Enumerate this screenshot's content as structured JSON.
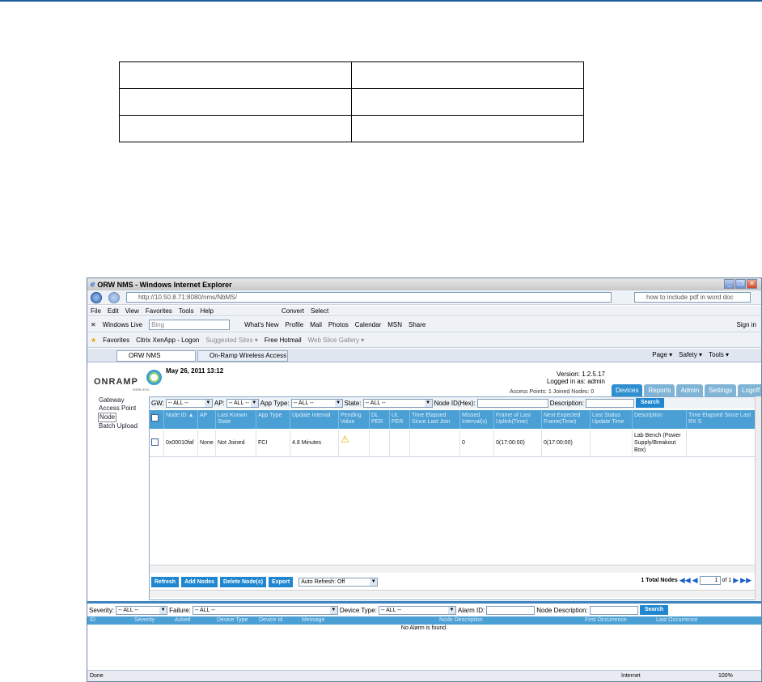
{
  "browser": {
    "title": "ORW NMS - Windows Internet Explorer",
    "url": "http://10.50.8.71:8080/nms/NbMS/",
    "search_text": "how to include pdf in word doc",
    "menu": [
      "File",
      "Edit",
      "View",
      "Favorites",
      "Tools",
      "Help"
    ],
    "convert_label": "Convert",
    "select_label": "Select",
    "toolbar2": {
      "windows_live": "Windows Live",
      "bing_placeholder": "Bing",
      "links": [
        "What's New",
        "Profile",
        "Mail",
        "Photos",
        "Calendar",
        "MSN",
        "Share"
      ],
      "sign_in": "Sign in"
    },
    "favorites": {
      "label": "Favorites",
      "items": [
        "Citrix XenApp - Logon",
        "Suggested Sites ▾",
        "Free Hotmail",
        "Web Slice Gallery ▾"
      ]
    },
    "tabs": [
      "ORW NMS",
      "On-Ramp Wireless Access Po..."
    ],
    "cmd": [
      "Page ▾",
      "Safety ▾",
      "Tools ▾"
    ],
    "status_left": "Done",
    "status_zone": "Internet",
    "status_zoom": "100%"
  },
  "app": {
    "logo": "ONRAMP",
    "logo_sub": "WIRELESS",
    "date": "May 26, 2011 13:12",
    "version": "Version: 1.2.5.17",
    "logged_in": "Logged in as: admin",
    "counts": "Access Points: 1 Joined Nodes: 0",
    "nav_tabs": [
      "Devices",
      "Reports",
      "Admin",
      "Settings",
      "Logoff"
    ],
    "sidebar": [
      "Gateway",
      "Access Point",
      "Node",
      "Batch Upload"
    ],
    "filters": {
      "gw_label": "GW:",
      "gw_value": "-- ALL --",
      "ap_label": "AP:",
      "ap_value": "-- ALL --",
      "apptype_label": "App Type:",
      "apptype_value": "-- ALL --",
      "state_label": "State:",
      "state_value": "-- ALL --",
      "nodeid_label": "Node ID(Hex):",
      "desc_label": "Description:",
      "search": "Search"
    },
    "columns": [
      "Node ID ▲",
      "AP",
      "Last Known State",
      "App Type",
      "Update Interval",
      "Pending Value",
      "DL PER",
      "UL PER",
      "Time Elapsed Since Last Join",
      "Missed Interval(s)",
      "Frame of Last Uplink(Time)",
      "Next Expected Frame(Time)",
      "Last Status Update Time",
      "Description",
      "Time Elapsed Since Last RX S"
    ],
    "row": [
      "0x00010faf",
      "None",
      "Not Joined",
      "FCI",
      "4.8 Minutes",
      "⚠",
      "",
      "",
      "",
      "0",
      "0(17:00:00)",
      "0(17:00:00)",
      "",
      "Lab Bench (Power Supply/Breakout Box)",
      ""
    ],
    "buttons": {
      "refresh": "Refresh",
      "add": "Add Nodes",
      "delete": "Delete Node(s)",
      "export": "Export",
      "auto_refresh": "Auto Refresh: Off"
    },
    "pager": {
      "total": "1 Total Nodes",
      "page": "1",
      "of": "of 1"
    }
  },
  "alarm": {
    "severity_label": "Severity:",
    "severity_value": "-- ALL --",
    "failure_label": "Failure:",
    "failure_value": "-- ALL --",
    "device_type_label": "Device Type:",
    "device_type_value": "-- ALL --",
    "alarm_id_label": "Alarm ID:",
    "node_desc_label": "Node Description:",
    "search": "Search",
    "columns": [
      "ID",
      "Severity",
      "Acked",
      "Device Type",
      "Device Id",
      "Message",
      "Node Description",
      "First Occurrence",
      "Last Occurrence"
    ],
    "empty": "No Alarm is found."
  }
}
